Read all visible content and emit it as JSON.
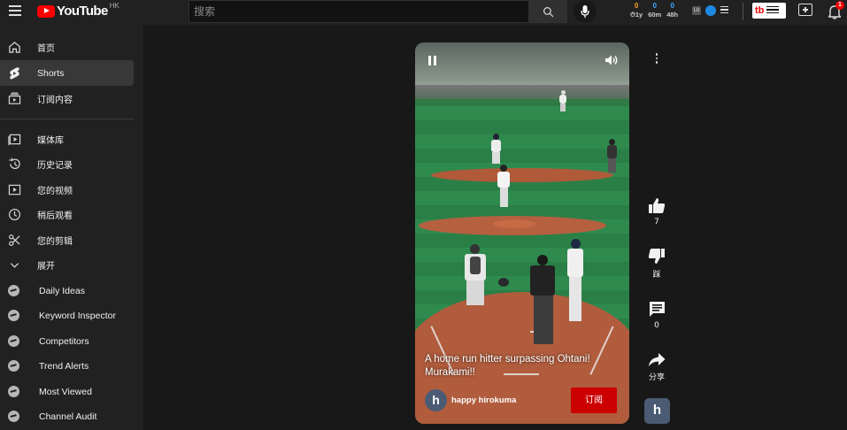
{
  "topbar": {
    "logo_text": "YouTube",
    "region": "HK",
    "search_placeholder": "搜索",
    "stats": [
      {
        "value": "0",
        "label": "⏱1y"
      },
      {
        "value": "0",
        "label": "60m"
      },
      {
        "value": "0",
        "label": "48h"
      }
    ],
    "ext_label": "Lb",
    "tb_label": "tb",
    "notification_count": "1",
    "icons": [
      "menu-icon",
      "search-icon",
      "mic-icon",
      "create-icon",
      "bell-icon"
    ]
  },
  "sidebar": {
    "items": [
      {
        "label": "首页",
        "icon": "home-icon"
      },
      {
        "label": "Shorts",
        "icon": "shorts-icon",
        "active": true
      },
      {
        "label": "订阅内容",
        "icon": "subscriptions-icon"
      },
      {
        "label": "媒体库",
        "icon": "library-icon"
      },
      {
        "label": "历史记录",
        "icon": "history-icon"
      },
      {
        "label": "您的视频",
        "icon": "your-videos-icon"
      },
      {
        "label": "稍后观看",
        "icon": "watch-later-icon"
      },
      {
        "label": "您的剪辑",
        "icon": "clips-icon"
      },
      {
        "label": "展开",
        "icon": "chevron-down-icon"
      }
    ],
    "tools": [
      {
        "label": "Daily Ideas"
      },
      {
        "label": "Keyword Inspector"
      },
      {
        "label": "Competitors"
      },
      {
        "label": "Trend Alerts"
      },
      {
        "label": "Most Viewed"
      },
      {
        "label": "Channel Audit"
      }
    ]
  },
  "short": {
    "caption_line1": "A home run hitter surpassing Ohtani!",
    "caption_line2": "Murakami!!",
    "channel_initial": "h",
    "channel_name": "happy hirokuma",
    "subscribe_label": "订阅"
  },
  "actions": {
    "likes": "7",
    "dislike_label": "踩",
    "comments": "0",
    "share_label": "分享"
  },
  "colors": {
    "accent_red": "#cc0000",
    "link_blue": "#3ea6ff",
    "stat_orange": "#f5a623"
  }
}
